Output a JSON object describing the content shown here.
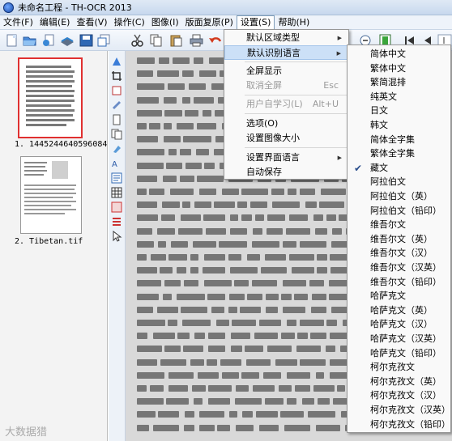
{
  "window": {
    "title": "未命名工程 - TH-OCR 2013"
  },
  "menubar": {
    "items": [
      "文件(F)",
      "编辑(E)",
      "查看(V)",
      "操作(C)",
      "图像(I)",
      "版面复原(P)",
      "设置(S)",
      "帮助(H)"
    ]
  },
  "thumbnails": [
    {
      "label": "1. 1445244640596084."
    },
    {
      "label": "2. Tibetan.tif"
    }
  ],
  "settings_menu": {
    "items": [
      {
        "label": "默认区域类型",
        "submenu": true
      },
      {
        "label": "默认识别语言",
        "submenu": true,
        "highlighted": true
      },
      {
        "label": "全屏显示"
      },
      {
        "label": "取消全屏",
        "shortcut": "Esc",
        "disabled": true
      },
      {
        "label": "用户自学习(L)",
        "shortcut": "Alt+U",
        "disabled": true
      },
      {
        "label": "选项(O)"
      },
      {
        "label": "设置图像大小"
      },
      {
        "label": "设置界面语言",
        "submenu": true
      },
      {
        "label": "自动保存"
      }
    ]
  },
  "language_menu": {
    "items": [
      "简体中文",
      "繁体中文",
      "繁简混排",
      "纯英文",
      "日文",
      "韩文",
      "简体全字集",
      "繁体全字集",
      "藏文",
      "阿拉伯文",
      "阿拉伯文（英）",
      "阿拉伯文（铅印）",
      "维吾尔文",
      "维吾尔文（英）",
      "维吾尔文（汉）",
      "维吾尔文（汉英）",
      "维吾尔文（铅印）",
      "哈萨克文",
      "哈萨克文（英）",
      "哈萨克文（汉）",
      "哈萨克文（汉英）",
      "哈萨克文（铅印）",
      "柯尔克孜文",
      "柯尔克孜文（英）",
      "柯尔克孜文（汉）",
      "柯尔克孜文（汉英）",
      "柯尔克孜文（铅印）"
    ],
    "checked": "藏文"
  },
  "watermark": "大数据猎",
  "colors": {
    "menu_highlight": "#cce0f7",
    "titlebar": "#dfe9f5",
    "thumb_border_selected": "#e03030"
  }
}
